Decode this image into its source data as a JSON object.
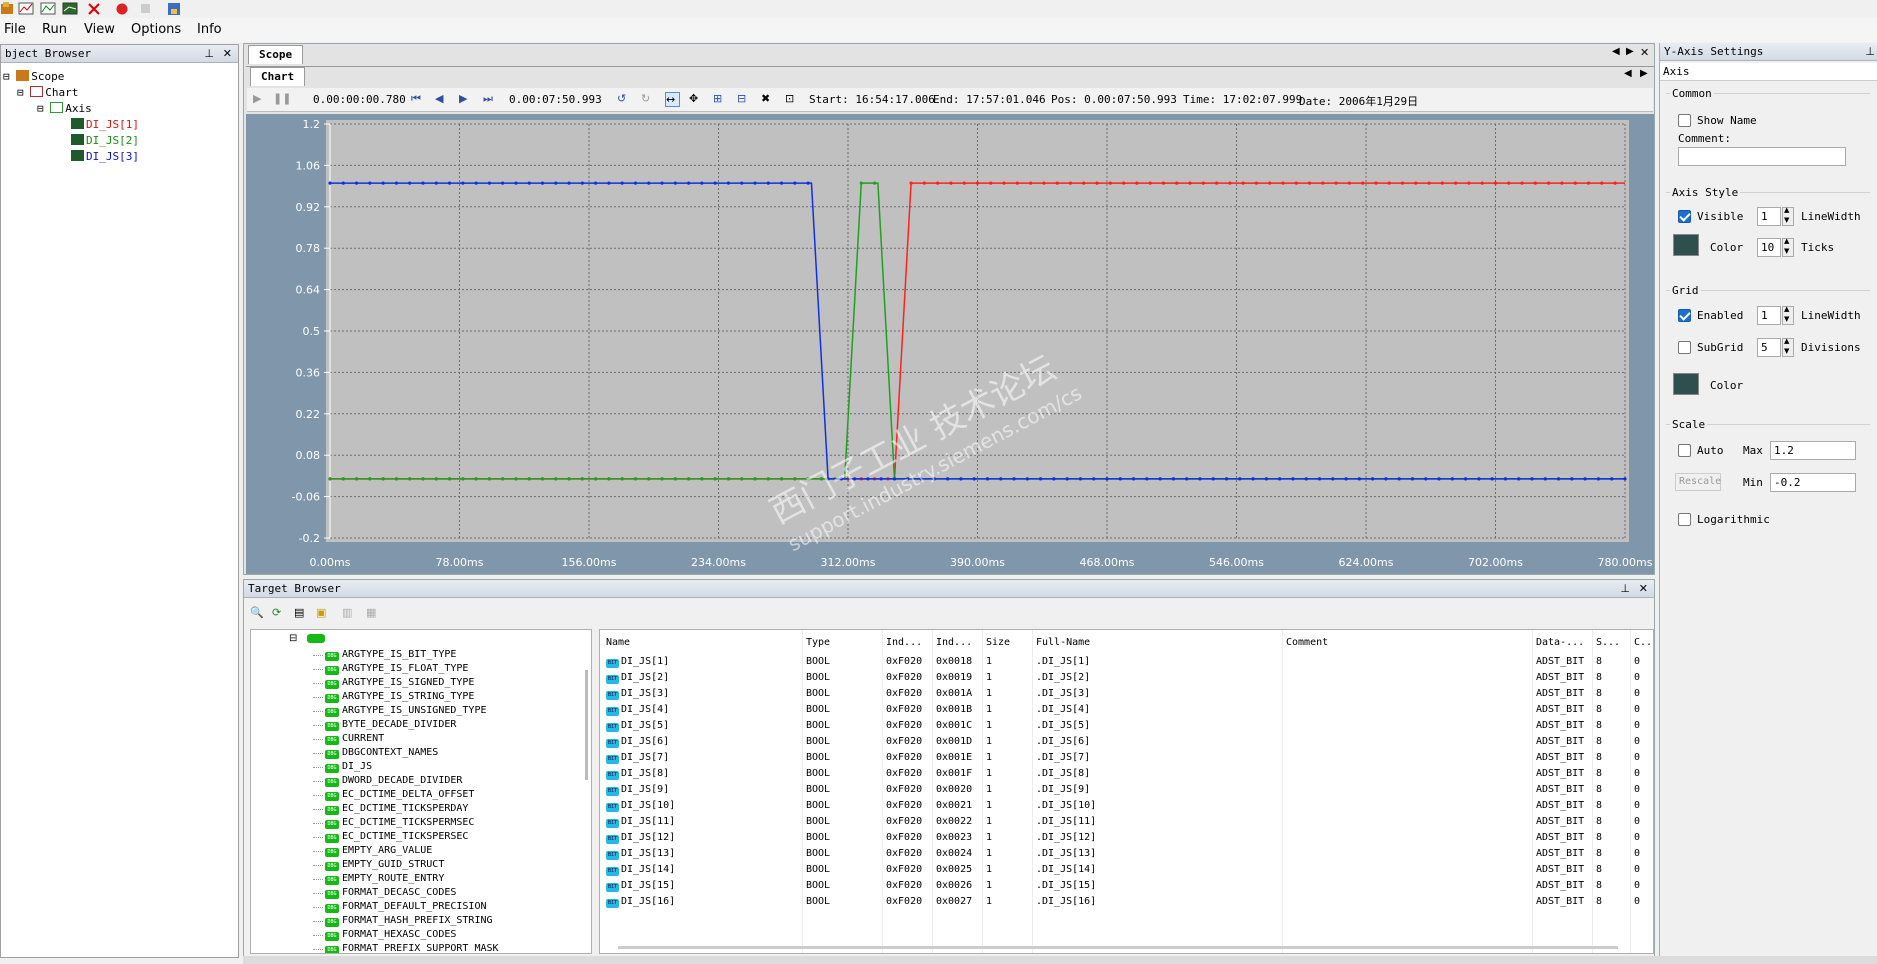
{
  "menu": {
    "file": "File",
    "run": "Run",
    "view": "View",
    "options": "Options",
    "info": "Info"
  },
  "object_browser": {
    "title": "bject Browser",
    "tree": {
      "scope": "Scope",
      "chart": "Chart",
      "axis": "Axis",
      "vars": [
        {
          "label": "DI_JS[1]",
          "color": "#e01010"
        },
        {
          "label": "DI_JS[2]",
          "color": "#109010"
        },
        {
          "label": "DI_JS[3]",
          "color": "#1010d0"
        }
      ]
    }
  },
  "scope": {
    "tab_scope": "Scope",
    "tab_chart": "Chart",
    "toolbar": {
      "time_offset": "0.00:00:00.780",
      "pos_time": "0.00:07:50.993",
      "start": "Start: 16:54:17.006",
      "end": "End:  17:57:01.046",
      "pos": "Pos:  0.00:07:50.993",
      "time": "Time: 17:02:07.999",
      "date": "Date:  2006年1月29日"
    }
  },
  "watermark": {
    "line1": "西门子工业 技术论坛",
    "line2": "support.industry.siemens.com/cs"
  },
  "chart_data": {
    "type": "line",
    "x_ticks": [
      "0.00ms",
      "78.00ms",
      "156.00ms",
      "234.00ms",
      "312.00ms",
      "390.00ms",
      "468.00ms",
      "546.00ms",
      "624.00ms",
      "702.00ms",
      "780.00ms"
    ],
    "y_ticks": [
      "1.2",
      "1.06",
      "0.92",
      "0.78",
      "0.64",
      "0.5",
      "0.36",
      "0.22",
      "0.08",
      "-0.06",
      "-0.2"
    ],
    "xlim": [
      0,
      780
    ],
    "ylim": [
      -0.2,
      1.2
    ],
    "grid": true,
    "series": [
      {
        "name": "DI_JS[1]",
        "color": "#ff2020",
        "points": [
          [
            0,
            0
          ],
          [
            340,
            0
          ],
          [
            350,
            1
          ],
          [
            780,
            1
          ]
        ]
      },
      {
        "name": "DI_JS[2]",
        "color": "#20a020",
        "points": [
          [
            0,
            0
          ],
          [
            310,
            0
          ],
          [
            320,
            1
          ],
          [
            330,
            1
          ],
          [
            340,
            0
          ],
          [
            780,
            0
          ]
        ]
      },
      {
        "name": "DI_JS[3]",
        "color": "#1030e0",
        "points": [
          [
            0,
            1
          ],
          [
            290,
            1
          ],
          [
            300,
            0
          ],
          [
            780,
            0
          ]
        ]
      }
    ]
  },
  "yaxis": {
    "title": "Y-Axis Settings",
    "axis_tab": "Axis",
    "common": {
      "group": "Common",
      "show_name": "Show Name",
      "comment_label": "Comment:",
      "comment_value": ""
    },
    "axis_style": {
      "group": "Axis Style",
      "visible": "Visible",
      "linewidth_value": "1",
      "linewidth_label": "LineWidth",
      "color_label": "Color",
      "ticks_value": "10",
      "ticks_label": "Ticks",
      "color": "#2f4f4f"
    },
    "grid": {
      "group": "Grid",
      "enabled": "Enabled",
      "linewidth_value": "1",
      "linewidth_label": "LineWidth",
      "subgrid": "SubGrid",
      "divisions_value": "5",
      "divisions_label": "Divisions",
      "color_label": "Color",
      "color": "#2f4f4f"
    },
    "scale": {
      "group": "Scale",
      "auto": "Auto",
      "max_label": "Max",
      "max_value": "1.2",
      "rescale": "Rescale",
      "min_label": "Min",
      "min_value": "-0.2",
      "logarithmic": "Logarithmic"
    }
  },
  "target_browser": {
    "title": "Target Browser",
    "tree_items": [
      "ARGTYPE_IS_BIT_TYPE",
      "ARGTYPE_IS_FLOAT_TYPE",
      "ARGTYPE_IS_SIGNED_TYPE",
      "ARGTYPE_IS_STRING_TYPE",
      "ARGTYPE_IS_UNSIGNED_TYPE",
      "BYTE_DECADE_DIVIDER",
      "CURRENT",
      "DBGCONTEXT_NAMES",
      "DI_JS",
      "DWORD_DECADE_DIVIDER",
      "EC_DCTIME_DELTA_OFFSET",
      "EC_DCTIME_TICKSPERDAY",
      "EC_DCTIME_TICKSPERMSEC",
      "EC_DCTIME_TICKSPERSEC",
      "EMPTY_ARG_VALUE",
      "EMPTY_GUID_STRUCT",
      "EMPTY_ROUTE_ENTRY",
      "FORMAT_DECASC_CODES",
      "FORMAT_DEFAULT_PRECISION",
      "FORMAT_HASH_PREFIX_STRING",
      "FORMAT_HEXASC_CODES",
      "FORMAT_PREFIX_SUPPORT_MASK"
    ],
    "columns": [
      "Name",
      "Type",
      "Ind...",
      "Ind...",
      "Size",
      "Full-Name",
      "Comment",
      "Data-...",
      "S...",
      "C..."
    ],
    "rows": [
      [
        "DI_JS[1]",
        "BOOL",
        "0xF020",
        "0x0018",
        "1",
        ".DI_JS[1]",
        "",
        "ADST_BIT",
        "8",
        "0"
      ],
      [
        "DI_JS[2]",
        "BOOL",
        "0xF020",
        "0x0019",
        "1",
        ".DI_JS[2]",
        "",
        "ADST_BIT",
        "8",
        "0"
      ],
      [
        "DI_JS[3]",
        "BOOL",
        "0xF020",
        "0x001A",
        "1",
        ".DI_JS[3]",
        "",
        "ADST_BIT",
        "8",
        "0"
      ],
      [
        "DI_JS[4]",
        "BOOL",
        "0xF020",
        "0x001B",
        "1",
        ".DI_JS[4]",
        "",
        "ADST_BIT",
        "8",
        "0"
      ],
      [
        "DI_JS[5]",
        "BOOL",
        "0xF020",
        "0x001C",
        "1",
        ".DI_JS[5]",
        "",
        "ADST_BIT",
        "8",
        "0"
      ],
      [
        "DI_JS[6]",
        "BOOL",
        "0xF020",
        "0x001D",
        "1",
        ".DI_JS[6]",
        "",
        "ADST_BIT",
        "8",
        "0"
      ],
      [
        "DI_JS[7]",
        "BOOL",
        "0xF020",
        "0x001E",
        "1",
        ".DI_JS[7]",
        "",
        "ADST_BIT",
        "8",
        "0"
      ],
      [
        "DI_JS[8]",
        "BOOL",
        "0xF020",
        "0x001F",
        "1",
        ".DI_JS[8]",
        "",
        "ADST_BIT",
        "8",
        "0"
      ],
      [
        "DI_JS[9]",
        "BOOL",
        "0xF020",
        "0x0020",
        "1",
        ".DI_JS[9]",
        "",
        "ADST_BIT",
        "8",
        "0"
      ],
      [
        "DI_JS[10]",
        "BOOL",
        "0xF020",
        "0x0021",
        "1",
        ".DI_JS[10]",
        "",
        "ADST_BIT",
        "8",
        "0"
      ],
      [
        "DI_JS[11]",
        "BOOL",
        "0xF020",
        "0x0022",
        "1",
        ".DI_JS[11]",
        "",
        "ADST_BIT",
        "8",
        "0"
      ],
      [
        "DI_JS[12]",
        "BOOL",
        "0xF020",
        "0x0023",
        "1",
        ".DI_JS[12]",
        "",
        "ADST_BIT",
        "8",
        "0"
      ],
      [
        "DI_JS[13]",
        "BOOL",
        "0xF020",
        "0x0024",
        "1",
        ".DI_JS[13]",
        "",
        "ADST_BIT",
        "8",
        "0"
      ],
      [
        "DI_JS[14]",
        "BOOL",
        "0xF020",
        "0x0025",
        "1",
        ".DI_JS[14]",
        "",
        "ADST_BIT",
        "8",
        "0"
      ],
      [
        "DI_JS[15]",
        "BOOL",
        "0xF020",
        "0x0026",
        "1",
        ".DI_JS[15]",
        "",
        "ADST_BIT",
        "8",
        "0"
      ],
      [
        "DI_JS[16]",
        "BOOL",
        "0xF020",
        "0x0027",
        "1",
        ".DI_JS[16]",
        "",
        "ADST_BIT",
        "8",
        "0"
      ]
    ]
  }
}
